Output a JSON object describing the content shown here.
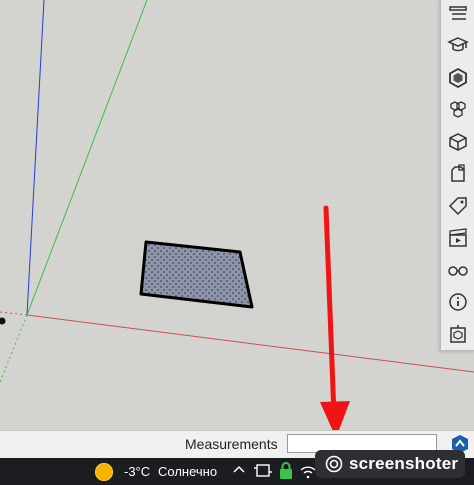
{
  "status_bar": {
    "measurements_label": "Measurements",
    "measurements_value": ""
  },
  "taskbar": {
    "temperature": "-3°C",
    "weather": "Солнечно"
  },
  "overlay": {
    "brand": "screenshoter"
  },
  "tray_icons": [
    "default-tray-icon",
    "instructor-icon",
    "materials-icon",
    "components-icon",
    "styles-icon",
    "tags-icon",
    "scenes-icon",
    "shadows-icon",
    "entity-info-icon",
    "outliner-icon",
    "extension-icon"
  ],
  "colors": {
    "axis_blue": "#2a3bd8",
    "axis_green": "#3dbf3d",
    "axis_red": "#c85050",
    "annotation_arrow": "#f01414",
    "face_fill": "#8f95a8"
  }
}
